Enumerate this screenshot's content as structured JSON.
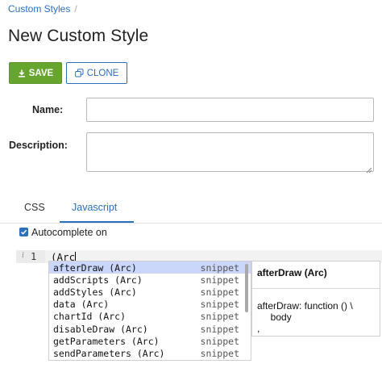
{
  "breadcrumb": {
    "link": "Custom Styles",
    "separator": "/"
  },
  "page": {
    "title": "New Custom Style"
  },
  "toolbar": {
    "save_label": "SAVE",
    "clone_label": "CLONE"
  },
  "form": {
    "name_label": "Name:",
    "name_value": "",
    "description_label": "Description:",
    "description_value": ""
  },
  "tabs": [
    {
      "label": "CSS",
      "active": false
    },
    {
      "label": "Javascript",
      "active": true
    }
  ],
  "autocomplete_toggle": {
    "label": "Autocomplete on",
    "checked": true
  },
  "editor": {
    "gutter_icon": "i",
    "line_number": "1",
    "typed_text": "(Arc"
  },
  "autocomplete": {
    "items": [
      {
        "pre": "a",
        "match": "f",
        "mid": "t",
        "match2": "",
        "post": "erDraw (Arc)",
        "full": "afterDraw (Arc)",
        "meta": "snippet",
        "selected": true
      },
      {
        "full": "addScripts (Arc)",
        "meta": "snippet",
        "selected": false
      },
      {
        "full": "addStyles (Arc)",
        "meta": "snippet",
        "selected": false
      },
      {
        "full": "data (Arc)",
        "meta": "snippet",
        "selected": false
      },
      {
        "full": "chartId (Arc)",
        "meta": "snippet",
        "selected": false
      },
      {
        "full": "disableDraw (Arc)",
        "meta": "snippet",
        "selected": false
      },
      {
        "full": "getParameters (Arc)",
        "meta": "snippet",
        "selected": false
      },
      {
        "full": "sendParameters (Arc)",
        "meta": "snippet",
        "selected": false
      }
    ],
    "doc": {
      "title": "afterDraw (Arc)",
      "body": "afterDraw: function () \\\n     body\n,"
    }
  },
  "colors": {
    "accent": "#2c6fbd",
    "save_green": "#66a52e",
    "selection": "#cad6fa"
  },
  "icons": {
    "save": "download-icon",
    "clone": "copy-icon",
    "checkbox": "checkmark-icon",
    "resize": "resize-grip-icon"
  }
}
